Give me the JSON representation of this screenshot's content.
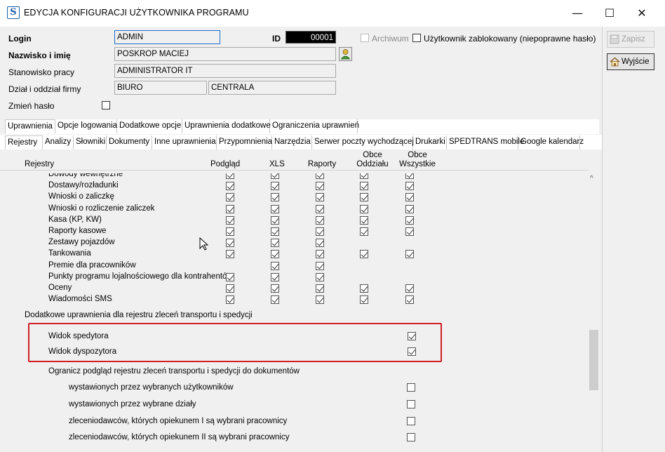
{
  "window": {
    "title": "EDYCJA KONFIGURACJI UŻYTKOWNIKA PROGRAMU",
    "app_icon_letter": "S",
    "minimize_glyph": "—",
    "maximize_glyph": "☐",
    "close_glyph": "✕"
  },
  "form": {
    "login_label": "Login",
    "login_value": "ADMIN",
    "id_label": "ID",
    "id_value": "00001",
    "archiwum_label": "Archiwum",
    "archiwum_checked": false,
    "zablokowany_label": "Użytkownik zablokowany (niepoprawne hasło)",
    "zablokowany_checked": false,
    "name_label": "Nazwisko i imię",
    "name_value": "POSKROP MACIEJ",
    "position_label": "Stanowisko pracy",
    "position_value": "ADMINISTRATOR IT",
    "dept_label": "Dział i oddział firmy",
    "dept_value": "BIURO",
    "branch_value": "CENTRALA",
    "password_label": "Zmień hasło",
    "password_checked": false
  },
  "actions": {
    "save_label": "Zapisz",
    "exit_label": "Wyjście"
  },
  "tabs_top": [
    {
      "label": "Uprawnienia",
      "selected": true
    },
    {
      "label": "Opcje logowania",
      "selected": false
    },
    {
      "label": "Dodatkowe opcje",
      "selected": false
    },
    {
      "label": "Uprawnienia dodatkowe",
      "selected": false
    },
    {
      "label": "Ograniczenia uprawnień",
      "selected": false
    }
  ],
  "tabs_sub": [
    {
      "label": "Rejestry",
      "selected": true
    },
    {
      "label": "Analizy",
      "selected": false
    },
    {
      "label": "Słowniki",
      "selected": false
    },
    {
      "label": "Dokumenty",
      "selected": false
    },
    {
      "label": "Inne uprawnienia",
      "selected": false
    },
    {
      "label": "Przypomnienia",
      "selected": false
    },
    {
      "label": "Narzędzia",
      "selected": false
    },
    {
      "label": "Serwer poczty wychodzącej",
      "selected": false
    },
    {
      "label": "Drukarki",
      "selected": false
    },
    {
      "label": "SPEDTRANS mobile",
      "selected": false
    },
    {
      "label": "Google kalendarz",
      "selected": false
    }
  ],
  "table": {
    "columns": [
      "Rejestry",
      "Podgląd",
      "XLS",
      "Raporty",
      "Obce Oddziału",
      "Obce Wszystkie"
    ],
    "col_top_lines": [
      "",
      "",
      "",
      "",
      "Obce",
      "Obce"
    ],
    "col_bottom_lines": [
      "Rejestry",
      "Podgląd",
      "XLS",
      "Raporty",
      "Oddziału",
      "Wszystkie"
    ],
    "rows": [
      {
        "label": "Dowody wewnętrzne",
        "checks": [
          true,
          true,
          true,
          true,
          true
        ]
      },
      {
        "label": "Dostawy/rozładunki",
        "checks": [
          true,
          true,
          true,
          true,
          true
        ]
      },
      {
        "label": "Wnioski o zaliczkę",
        "checks": [
          true,
          true,
          true,
          true,
          true
        ]
      },
      {
        "label": "Wnioski o rozliczenie zaliczek",
        "checks": [
          true,
          true,
          true,
          true,
          true
        ]
      },
      {
        "label": "Kasa (KP, KW)",
        "checks": [
          true,
          true,
          true,
          true,
          true
        ]
      },
      {
        "label": "Raporty kasowe",
        "checks": [
          true,
          true,
          true,
          true,
          true
        ]
      },
      {
        "label": "Zestawy pojazdów",
        "checks": [
          true,
          true,
          true,
          null,
          null
        ]
      },
      {
        "label": "Tankowania",
        "checks": [
          true,
          true,
          true,
          true,
          true
        ]
      },
      {
        "label": "Premie dla pracowników",
        "checks": [
          null,
          true,
          true,
          null,
          null
        ]
      },
      {
        "label": "Punkty programu lojalnościowego dla kontrahentów",
        "checks": [
          true,
          true,
          true,
          null,
          null
        ]
      },
      {
        "label": "Oceny",
        "checks": [
          true,
          true,
          true,
          true,
          true
        ]
      },
      {
        "label": "Wiadomości SMS",
        "checks": [
          true,
          true,
          true,
          true,
          true
        ]
      }
    ]
  },
  "extra": {
    "section_title": "Dodatkowe uprawnienia dla rejestru zleceń transportu i spedycji",
    "items": [
      {
        "label": "Widok spedytora",
        "checked": true
      },
      {
        "label": "Widok dyspozytora",
        "checked": true
      }
    ],
    "restrict_title": "Ogranicz podgląd rejestru zleceń transportu i spedycji do dokumentów",
    "restrict_items": [
      {
        "label": "wystawionych przez wybranych użytkowników",
        "checked": false
      },
      {
        "label": "wystawionych przez wybrane działy",
        "checked": false
      },
      {
        "label": "zleceniodawców, których opiekunem I są wybrani pracownicy",
        "checked": false
      },
      {
        "label": "zleceniodawców, których opiekunem II są wybrani pracownicy",
        "checked": false
      }
    ]
  },
  "colors": {
    "accent_border": "#1c6cc4",
    "id_bg": "#000000",
    "highlight": "#d11f25"
  }
}
